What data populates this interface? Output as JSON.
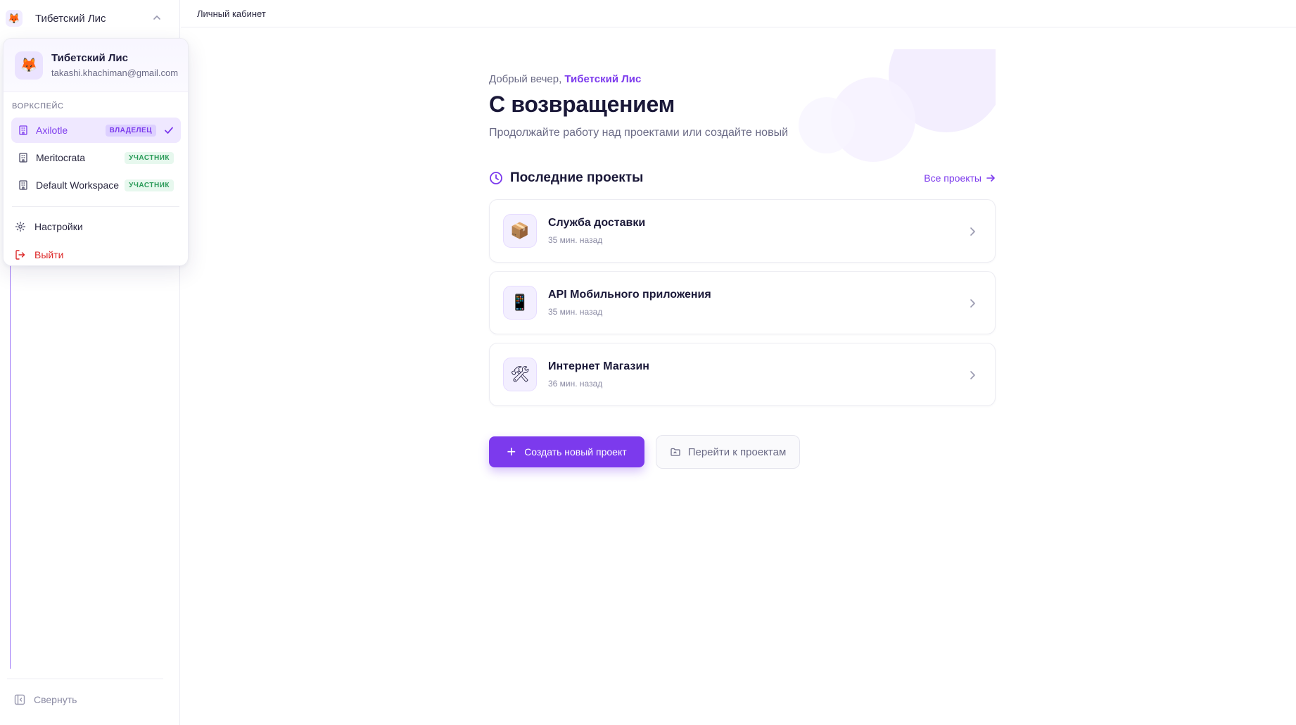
{
  "sidebar": {
    "workspace_name": "Тибетский Лис",
    "avatar_emoji": "🦊",
    "collapse_label": "Свернуть"
  },
  "dropdown": {
    "user_name": "Тибетский Лис",
    "user_email": "takashi.khachiman@gmail.com",
    "avatar_emoji": "🦊",
    "section_label": "ВОРКСПЕЙС",
    "workspaces": [
      {
        "name": "Axilotle",
        "role": "ВЛАДЕЛЕЦ",
        "active": true
      },
      {
        "name": "Meritocrata",
        "role": "УЧАСТНИК",
        "active": false
      },
      {
        "name": "Default Workspace",
        "role": "УЧАСТНИК",
        "active": false
      }
    ],
    "settings_label": "Настройки",
    "logout_label": "Выйти"
  },
  "topbar": {
    "breadcrumb": "Личный кабинет"
  },
  "hero": {
    "greeting_prefix": "Добрый вечер,",
    "greeting_name": "Тибетский Лис",
    "title": "С возвращением",
    "subtitle": "Продолжайте работу над проектами или создайте новый"
  },
  "recent": {
    "title": "Последние проекты",
    "all_link": "Все проекты",
    "projects": [
      {
        "name": "Служба доставки",
        "time": "35 мин. назад",
        "icon": "📦"
      },
      {
        "name": "API Мобильного приложения",
        "time": "35 мин. назад",
        "icon": "📱"
      },
      {
        "name": "Интернет Магазин",
        "time": "36 мин. назад",
        "icon": "🛠"
      }
    ]
  },
  "actions": {
    "create_label": "Создать новый проект",
    "goto_label": "Перейти к проектам"
  },
  "colors": {
    "accent": "#7c3aed",
    "accent_soft": "#efe8ff",
    "danger": "#dc2626",
    "success": "#2a9a58"
  }
}
